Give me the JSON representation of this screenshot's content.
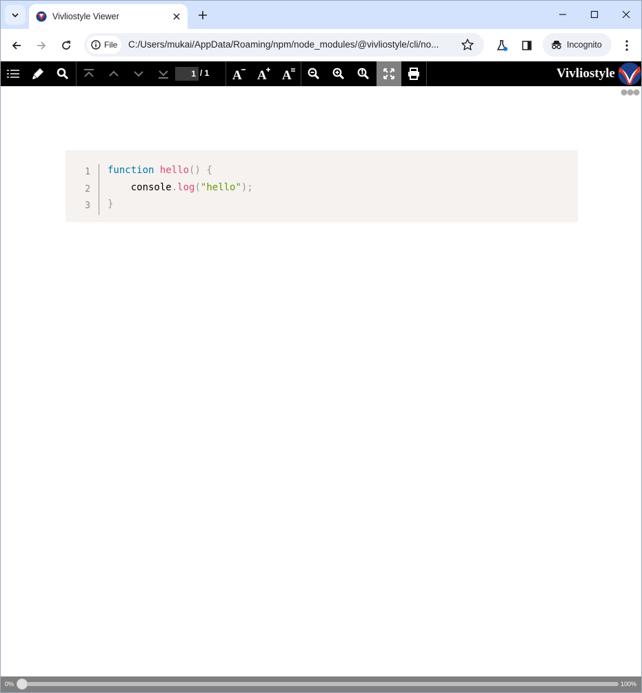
{
  "browser": {
    "tab_title": "Vivliostyle Viewer",
    "site_chip_label": "File",
    "url": "C:/Users/mukai/AppData/Roaming/npm/node_modules/@vivliostyle/cli/no...",
    "incognito_label": "Incognito"
  },
  "viewer": {
    "current_page": "1",
    "page_total": "/ 1",
    "brand": "Vivliostyle",
    "progress_start_label": "0%",
    "progress_end_label": "100%",
    "progress_value": 0
  },
  "code": {
    "line_numbers": [
      "1",
      "2",
      "3"
    ],
    "line1": {
      "keyword": "function",
      "name": "hello",
      "punct": "() {"
    },
    "line2": {
      "indent": "    ",
      "object": "console",
      "dot": ".",
      "method": "log",
      "open": "(",
      "string": "\"hello\"",
      "close": ");"
    },
    "line3": {
      "punct": "}"
    }
  },
  "colors": {
    "tab_strip": "#d3e3fd",
    "toolbar": "#000000",
    "code_bg": "#f5f2f0",
    "keyword": "#0077aa",
    "function": "#dd4a68",
    "string": "#669900",
    "punctuation": "#999999"
  }
}
